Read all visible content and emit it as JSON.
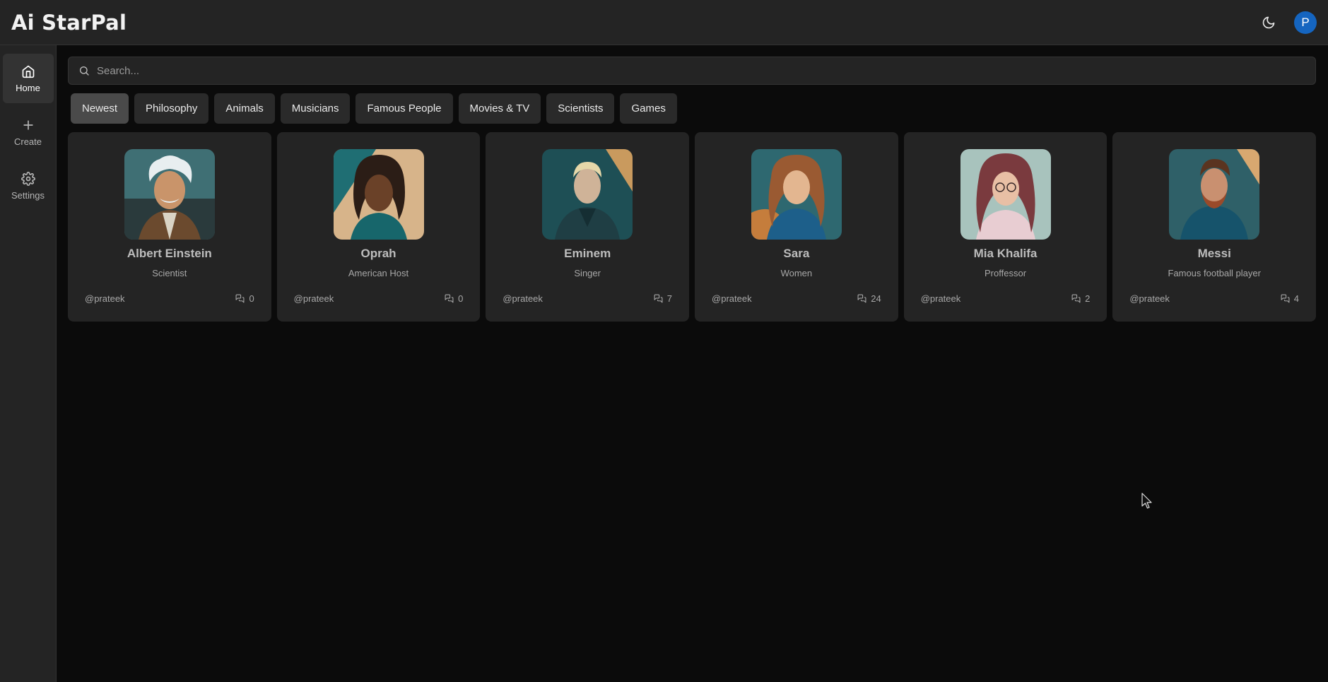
{
  "app": {
    "title": "Ai StarPal",
    "avatar_letter": "P",
    "accent": "#1565c0"
  },
  "sidebar": {
    "items": [
      {
        "label": "Home",
        "icon": "home-icon",
        "active": true
      },
      {
        "label": "Create",
        "icon": "plus-icon",
        "active": false
      },
      {
        "label": "Settings",
        "icon": "gear-icon",
        "active": false
      }
    ]
  },
  "search": {
    "placeholder": "Search..."
  },
  "categories": [
    "Newest",
    "Philosophy",
    "Animals",
    "Musicians",
    "Famous People",
    "Movies & TV",
    "Scientists",
    "Games"
  ],
  "active_category": "Newest",
  "companions": [
    {
      "name": "Albert Einstein",
      "description": "Scientist",
      "author": "@prateek",
      "messages": "0"
    },
    {
      "name": "Oprah",
      "description": "American Host",
      "author": "@prateek",
      "messages": "0"
    },
    {
      "name": "Eminem",
      "description": "Singer",
      "author": "@prateek",
      "messages": "7"
    },
    {
      "name": "Sara",
      "description": "Women",
      "author": "@prateek",
      "messages": "24"
    },
    {
      "name": "Mia Khalifa",
      "description": "Proffessor",
      "author": "@prateek",
      "messages": "2"
    },
    {
      "name": "Messi",
      "description": "Famous football player",
      "author": "@prateek",
      "messages": "4"
    }
  ]
}
